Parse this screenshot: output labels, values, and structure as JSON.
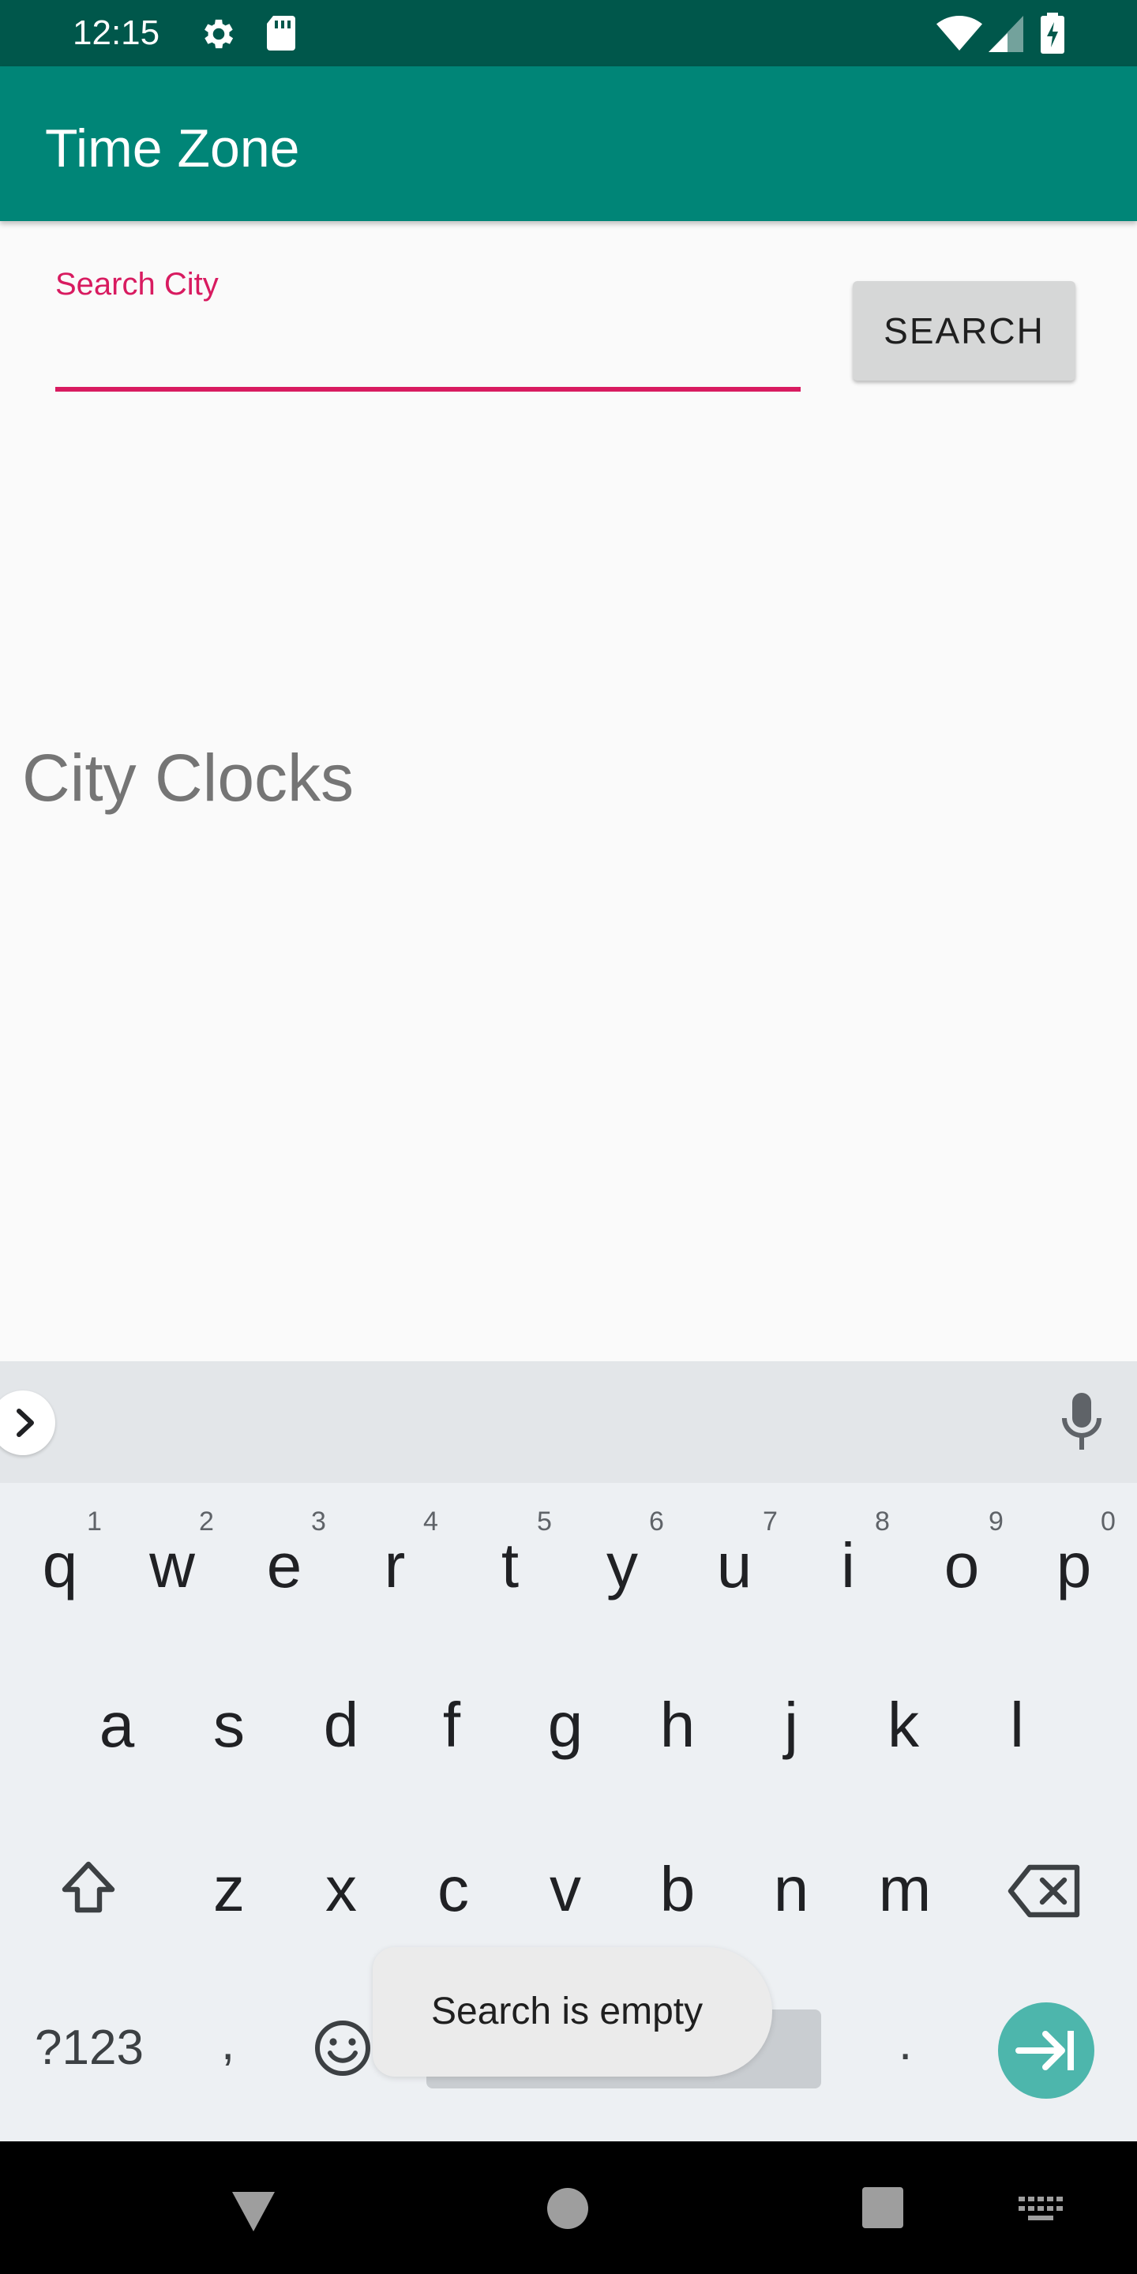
{
  "status_bar": {
    "time": "12:15",
    "icons": [
      "gear-icon",
      "sd-card-icon",
      "wifi-icon",
      "cell-signal-icon",
      "battery-charging-icon"
    ]
  },
  "app_bar": {
    "title": "Time Zone"
  },
  "search": {
    "label": "Search City",
    "value": "",
    "button_label": "SEARCH"
  },
  "city_clocks": {
    "heading": "City Clocks"
  },
  "keyboard": {
    "row1": [
      {
        "key": "q",
        "hint": "1"
      },
      {
        "key": "w",
        "hint": "2"
      },
      {
        "key": "e",
        "hint": "3"
      },
      {
        "key": "r",
        "hint": "4"
      },
      {
        "key": "t",
        "hint": "5"
      },
      {
        "key": "y",
        "hint": "6"
      },
      {
        "key": "u",
        "hint": "7"
      },
      {
        "key": "i",
        "hint": "8"
      },
      {
        "key": "o",
        "hint": "9"
      },
      {
        "key": "p",
        "hint": "0"
      }
    ],
    "row2": [
      "a",
      "s",
      "d",
      "f",
      "g",
      "h",
      "j",
      "k",
      "l"
    ],
    "row3": [
      "z",
      "x",
      "c",
      "v",
      "b",
      "n",
      "m"
    ],
    "symbols_label": "?123",
    "comma": ",",
    "period": "."
  },
  "toast": {
    "message": "Search is empty"
  },
  "colors": {
    "status_bar": "#00574b",
    "app_bar": "#008577",
    "accent": "#d81b60",
    "enter_key": "#4db6ac"
  }
}
